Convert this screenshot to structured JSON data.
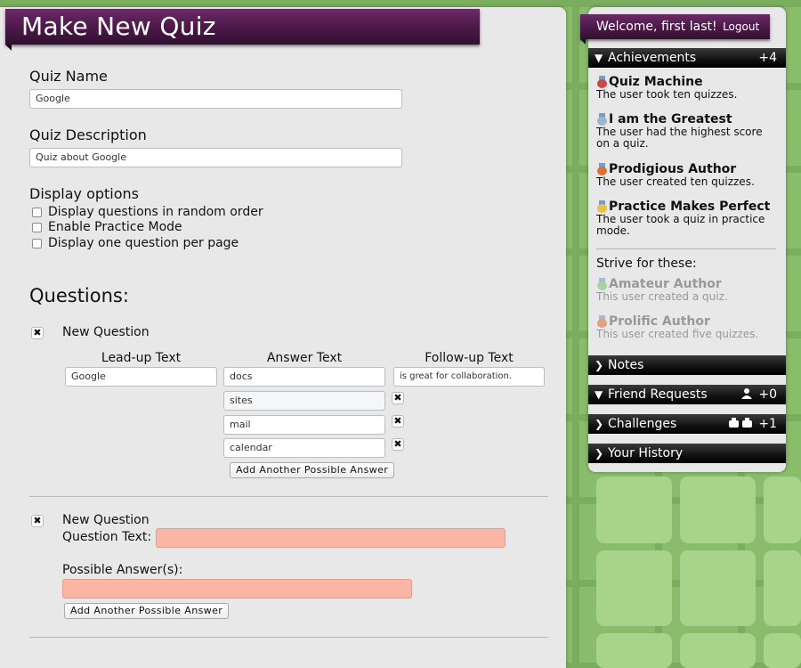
{
  "page": {
    "title": "Make New Quiz",
    "quiz_name_label": "Quiz Name",
    "quiz_name_value": "Google",
    "quiz_desc_label": "Quiz Description",
    "quiz_desc_value": "Quiz about Google",
    "display_options_label": "Display options",
    "options": [
      {
        "label": "Display questions in random order",
        "checked": false
      },
      {
        "label": "Enable Practice Mode",
        "checked": false
      },
      {
        "label": "Display one question per page",
        "checked": false
      }
    ],
    "questions_title": "Questions:"
  },
  "question1": {
    "type_label": "New Question",
    "col_lead": "Lead-up Text",
    "col_answer": "Answer Text",
    "col_follow": "Follow-up Text",
    "lead_value": "Google",
    "follow_value": "is great for collaboration.",
    "answers": [
      "docs",
      "sites",
      "mail",
      "calendar"
    ],
    "add_answer_label": "Add Another Possible Answer"
  },
  "question2": {
    "type_label": "New Question",
    "question_text_label": "Question Text:",
    "question_text_value": "",
    "possible_answers_label": "Possible Answer(s):",
    "answer_value": "",
    "add_answer_label": "Add Another Possible Answer"
  },
  "sidebar": {
    "welcome": "Welcome, first last!",
    "logout": "Logout",
    "achievements": {
      "label": "Achievements",
      "count": "+4",
      "earned": [
        {
          "title": "Quiz Machine",
          "desc": "The user took ten quizzes.",
          "medal": "#c94a4a"
        },
        {
          "title": "I am the Greatest",
          "desc": "The user had the highest score on a quiz.",
          "medal": "#9fb7cc"
        },
        {
          "title": "Prodigious Author",
          "desc": "The user created ten quizzes.",
          "medal": "#e0703a"
        },
        {
          "title": "Practice Makes Perfect",
          "desc": "The user took a quiz in practice mode.",
          "medal": "#e8c24a"
        }
      ],
      "strive_label": "Strive for these:",
      "strive": [
        {
          "title": "Amateur Author",
          "desc": "This user created a quiz.",
          "medal": "#7fc47a"
        },
        {
          "title": "Prolific Author",
          "desc": "This user created five quizzes.",
          "medal": "#e0703a"
        }
      ]
    },
    "notes": {
      "label": "Notes"
    },
    "friend_requests": {
      "label": "Friend Requests",
      "count": "+0"
    },
    "challenges": {
      "label": "Challenges",
      "count": "+1"
    },
    "history": {
      "label": "Your History"
    }
  }
}
